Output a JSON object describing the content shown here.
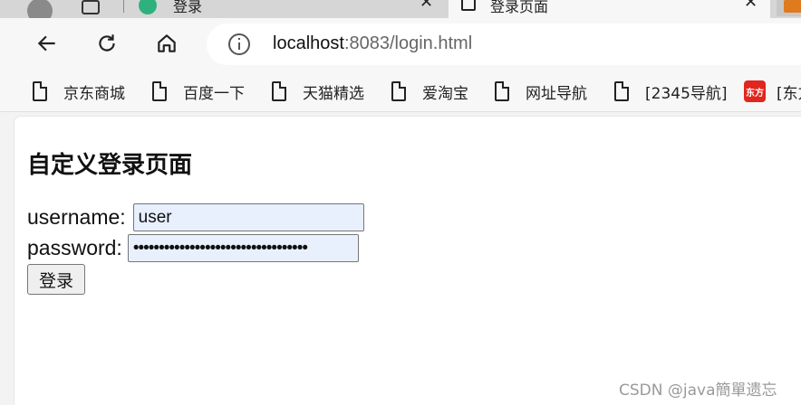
{
  "tabs": [
    {
      "title": "登录"
    },
    {
      "title": "登录页面"
    }
  ],
  "address_bar": {
    "url_host": "localhost",
    "url_rest": ":8083/login.html"
  },
  "bookmarks": [
    {
      "label": "京东商城"
    },
    {
      "label": "百度一下"
    },
    {
      "label": "天猫精选"
    },
    {
      "label": "爱淘宝"
    },
    {
      "label": "网址导航"
    },
    {
      "label": "[2345导航]"
    },
    {
      "label": "[东方",
      "icon_text": "东方"
    }
  ],
  "page": {
    "heading": "自定义登录页面",
    "username_label": "username:",
    "username_value": "user",
    "password_label": "password:",
    "password_value": "••••••••••••••••••••••••••••••••••",
    "login_button": "登录"
  },
  "watermark": "CSDN @java簡單遗忘",
  "icons": {
    "back": "back-arrow-icon",
    "reload": "reload-icon",
    "home": "home-icon",
    "info": "info-icon",
    "close": "close-icon",
    "bookmark": "page-icon"
  },
  "colors": {
    "autofill_bg": "#e8f0fe",
    "toolbar_bg": "#f7f7f7",
    "tabstrip_bg": "#d6d6d6"
  }
}
